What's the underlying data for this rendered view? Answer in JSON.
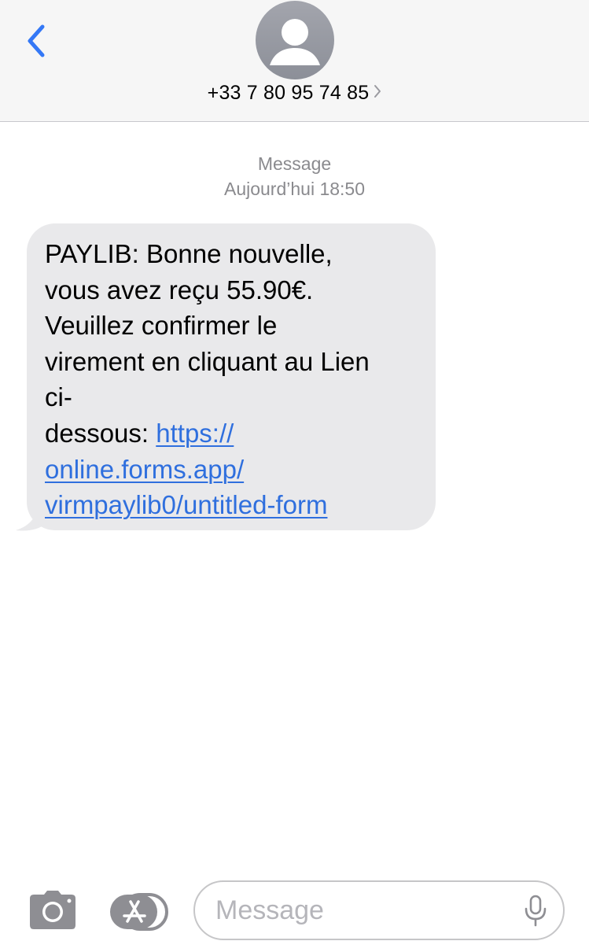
{
  "header": {
    "contact_number": "+33 7 80 95 74 85"
  },
  "conversation": {
    "service_label": "Message",
    "timestamp": "Aujourd’hui 18:50"
  },
  "message": {
    "lines": [
      "PAYLIB: Bonne nouvelle,",
      "vous avez reçu 55.90€.",
      "Veuillez confirmer le",
      "virement en cliquant au Lien",
      "ci-",
      "dessous: "
    ],
    "link_parts": [
      "https://",
      "online.forms.app/",
      "virmpaylib0/untitled-form"
    ]
  },
  "composer": {
    "placeholder": "Message"
  },
  "icons": {
    "back": "chevron-left-icon",
    "avatar": "person-icon",
    "contact_details": "chevron-right-icon",
    "camera": "camera-icon",
    "apps": "app-store-icon",
    "dictation": "microphone-icon"
  },
  "colors": {
    "accent": "#3478f6",
    "link": "#2f6fde",
    "bubble_received": "#e9e9eb",
    "header_background": "#f6f6f6",
    "secondary_text": "#8a8a8e"
  }
}
